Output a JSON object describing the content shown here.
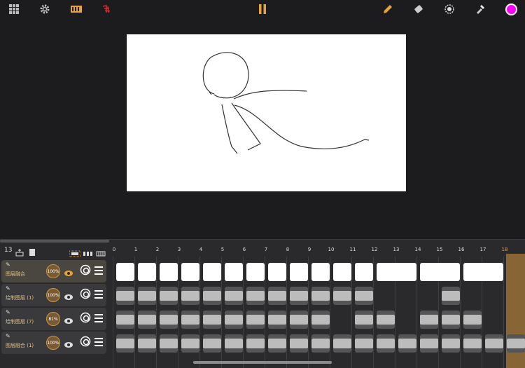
{
  "toolbar": {
    "left_icons": [
      "grid-icon",
      "gear-icon",
      "frames-film-icon",
      "onion-skin-icon"
    ],
    "center_icon": "pause-icon",
    "right_icons": [
      "pencil-icon",
      "eraser-icon",
      "blend-icon",
      "eyedropper-icon"
    ],
    "color_swatch": "#ff00ff",
    "accent": "#e5a33a"
  },
  "timeline": {
    "frame_count": "13",
    "current_frame": "18",
    "frame_numbers": [
      "0",
      "1",
      "2",
      "3",
      "4",
      "5",
      "6",
      "7",
      "8",
      "9",
      "10",
      "11",
      "12",
      "13",
      "14",
      "15",
      "16",
      "17",
      "18"
    ],
    "layers": [
      {
        "name": "图层融合",
        "opacity": "100%"
      },
      {
        "name": "绘制图层 (1)",
        "opacity": "100%"
      },
      {
        "name": "绘制图层 (7)",
        "opacity": "81%"
      },
      {
        "name": "图层融合 (1)",
        "opacity": "100%"
      }
    ]
  }
}
